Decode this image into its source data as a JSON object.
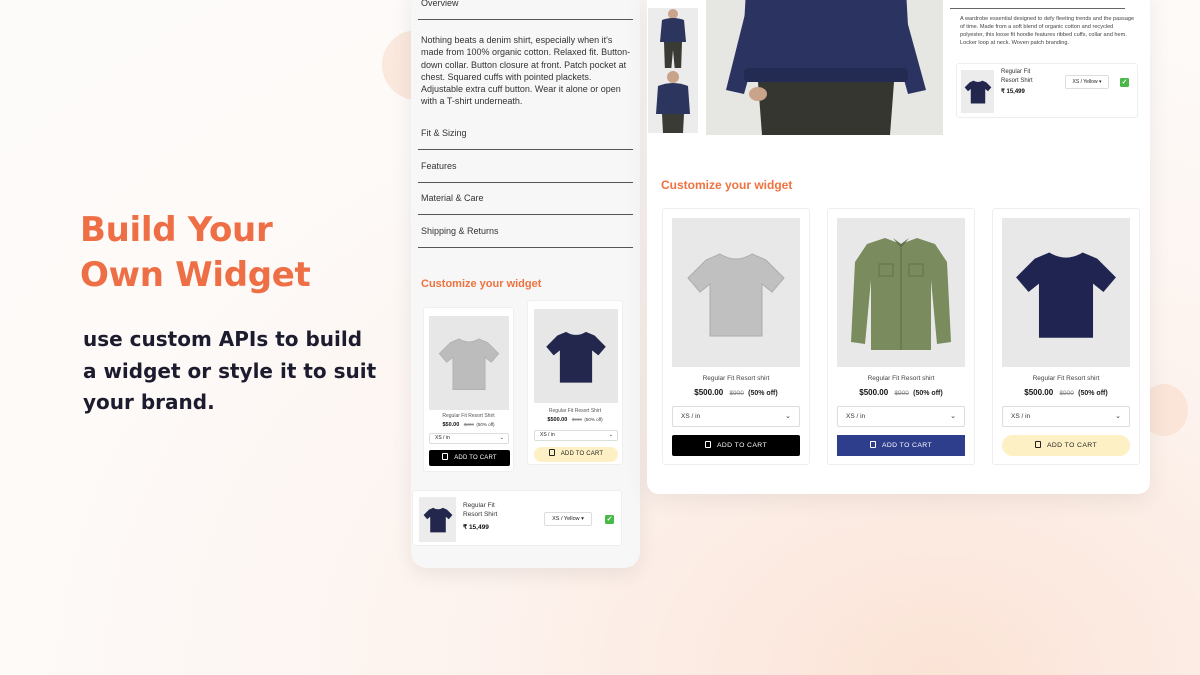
{
  "hero": {
    "title_line1": "Build Your",
    "title_line2": "Own Widget",
    "subtitle_line1": "use custom APIs to build",
    "subtitle_line2": "a widget or style it to suit",
    "subtitle_line3": "your brand."
  },
  "mobile": {
    "overview_label": "Overview",
    "description": "Nothing beats a denim shirt, especially when it's made from 100% organic cotton. Relaxed fit. Button-down collar. Button closure at front. Patch pocket at chest. Squared cuffs with pointed plackets. Adjustable extra cuff button. Wear it alone or open with a T-shirt underneath.",
    "accordion": [
      "Fit & Sizing",
      "Features",
      "Material & Care",
      "Shipping & Returns"
    ],
    "customize_title": "Customize your widget",
    "cards": [
      {
        "name": "Regular Fit Resort Shirt",
        "price": "$50.00",
        "old_price": "$300",
        "discount": "(50% off)",
        "size": "XS / in",
        "cta": "ADD TO CART",
        "tee_color": "#bcbcbc",
        "button_bg": "#000000",
        "button_fg": "#ffffff"
      },
      {
        "name": "Regular Fit Resort Shirt",
        "price": "$500.00",
        "old_price": "$900",
        "discount": "(50% off)",
        "size": "XS / in",
        "cta": "ADD TO CART",
        "tee_color": "#23274d",
        "button_bg": "#fdf0c4",
        "button_fg": "#222222"
      }
    ],
    "bundle": {
      "name_line1": "Regular Fit",
      "name_line2": "Resort Shirt",
      "price": "₹ 15,499",
      "variant": "XS / Yellow"
    }
  },
  "desktop": {
    "product_description": "A wardrobe essential designed to defy fleeting trends and the passage of time. Made from a soft blend of organic cotton and recycled polyester, this loose fit hoodie features ribbed cuffs, collar and hem. Locker loop at neck. Woven patch branding.",
    "bundle": {
      "name_line1": "Regular Fit",
      "name_line2": "Resort Shirt",
      "price": "₹ 15,499",
      "variant": "XS / Yellow"
    },
    "customize_title": "Customize your widget",
    "cards": [
      {
        "name": "Regular Fit Resort shirt",
        "price": "$500.00",
        "old_price": "$900",
        "discount": "(50% off)",
        "size": "XS / in",
        "cta": "ADD TO CART",
        "product_color": "#c0c0c0",
        "button_bg": "#000000",
        "button_fg": "#ffffff"
      },
      {
        "name": "Regular Fit Resort shirt",
        "price": "$500.00",
        "old_price": "$900",
        "discount": "(50% off)",
        "size": "XS / in",
        "cta": "ADD TO CART",
        "product_color": "#7a8c5e",
        "button_bg": "#2e3e8c",
        "button_fg": "#ffffff"
      },
      {
        "name": "Regular Fit Resort shirt",
        "price": "$500.00",
        "old_price": "$900",
        "discount": "(50% off)",
        "size": "XS / in",
        "cta": "ADD TO CART",
        "product_color": "#1f2550",
        "button_bg": "#fdf0c4",
        "button_fg": "#222222"
      }
    ]
  },
  "colors": {
    "accent": "#ee6f45",
    "heading_dark": "#1c1c2e",
    "check_green": "#46b946"
  },
  "icons": [
    "shopping-bag-icon",
    "chevron-down-icon",
    "checkbox-checked-icon"
  ]
}
